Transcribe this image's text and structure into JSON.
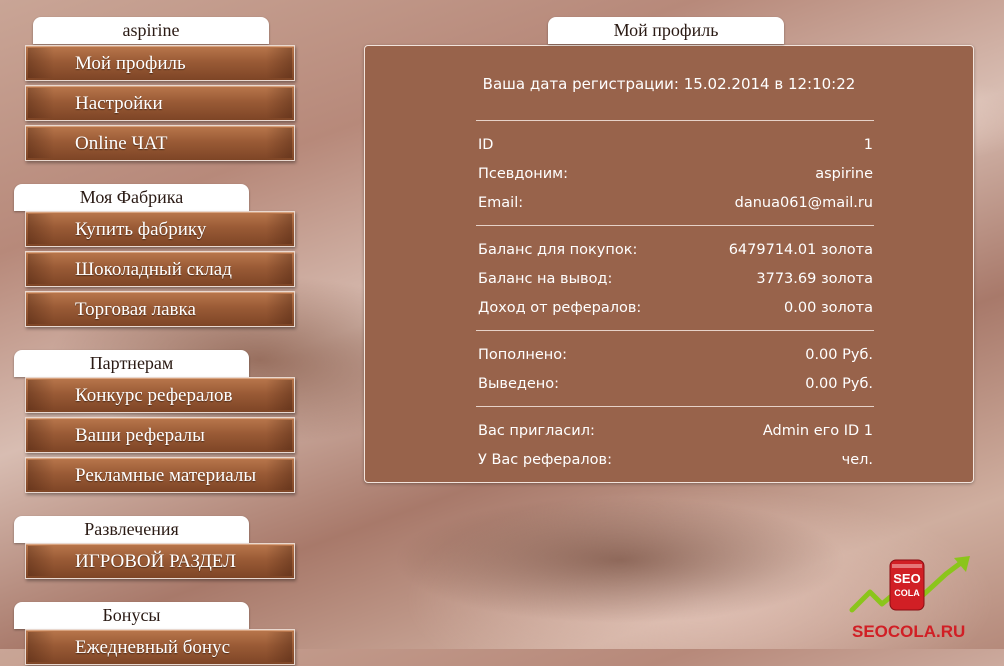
{
  "sidebar": {
    "sections": [
      {
        "title": "aspirine",
        "items": [
          "Мой профиль",
          "Настройки",
          "Online ЧАТ"
        ]
      },
      {
        "title": "Моя Фабрика",
        "items": [
          "Купить фабрику",
          "Шоколадный склад",
          "Торговая лавка"
        ]
      },
      {
        "title": "Партнерам",
        "items": [
          "Конкурс рефералов",
          "Ваши рефералы",
          "Рекламные материалы"
        ]
      },
      {
        "title": "Развлечения",
        "items": [
          "ИГРОВОЙ РАЗДЕЛ"
        ]
      },
      {
        "title": "Бонусы",
        "items": [
          "Ежедневный бонус"
        ]
      }
    ]
  },
  "profile": {
    "title": "Мой профиль",
    "registration": "Ваша дата регистрации: 15.02.2014 в 12:10:22",
    "rows": [
      {
        "label": "ID",
        "value": "1"
      },
      {
        "label": "Псевдоним:",
        "value": "aspirine"
      },
      {
        "label": "Email:",
        "value": "danua061@mail.ru"
      },
      {
        "label": "Баланс для покупок:",
        "value": "6479714.01 золота"
      },
      {
        "label": "Баланс на вывод:",
        "value": "3773.69 золота"
      },
      {
        "label": "Доход от рефералов:",
        "value": "0.00 золота"
      },
      {
        "label": "Пополнено:",
        "value": "0.00 Руб."
      },
      {
        "label": "Выведено:",
        "value": "0.00 Руб."
      },
      {
        "label": "Вас пригласил:",
        "value": "Admin его ID 1"
      },
      {
        "label": "У Вас рефералов:",
        "value": "чел."
      }
    ]
  },
  "logo": {
    "badge_top": "SEO",
    "badge_bottom": "COLA",
    "caption": "SEOCOLA.RU"
  },
  "colors": {
    "accent_brown": "#98634b",
    "button_brown": "#9a5b36",
    "logo_red": "#d11f25",
    "logo_green": "#8bc51b"
  }
}
